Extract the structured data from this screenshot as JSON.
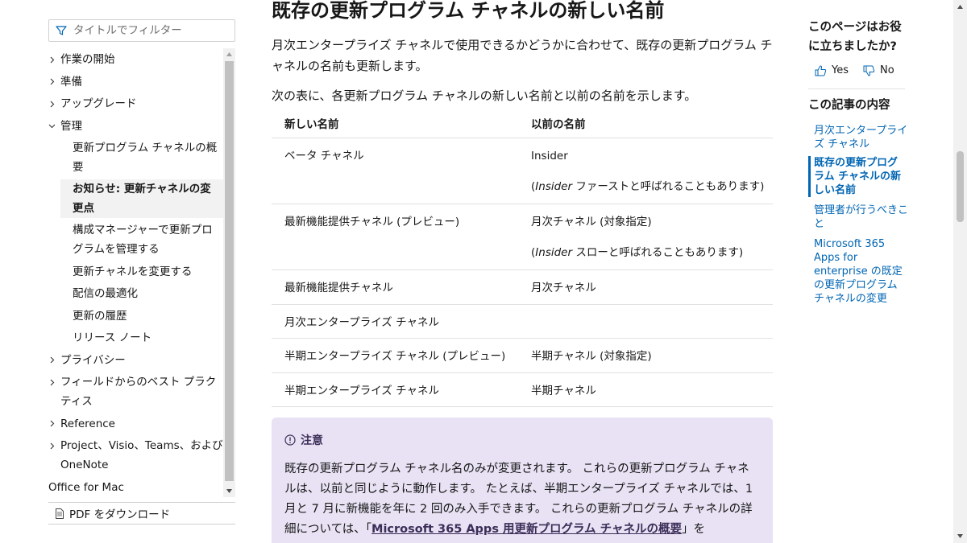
{
  "filter": {
    "placeholder": "タイトルでフィルター"
  },
  "toc": {
    "items": [
      {
        "label": "作業の開始",
        "expandable": true
      },
      {
        "label": "準備",
        "expandable": true
      },
      {
        "label": "アップグレード",
        "expandable": true
      },
      {
        "label": "管理",
        "expandable": true,
        "expanded": true
      }
    ],
    "children": [
      "更新プログラム チャネルの概要",
      "お知らせ: 更新チャネルの変更点",
      "構成マネージャーで更新プログラムを管理する",
      "更新チャネルを変更する",
      "配信の最適化",
      "更新の履歴",
      "リリース ノート"
    ],
    "after": [
      {
        "label": "プライバシー",
        "expandable": true
      },
      {
        "label": "フィールドからのベスト プラクティス",
        "expandable": true
      },
      {
        "label": "Reference",
        "expandable": true
      },
      {
        "label": "Project、Visio、Teams、および OneNote",
        "expandable": true
      },
      {
        "label": "Office for Mac",
        "expandable": false
      }
    ]
  },
  "pdf": {
    "label": "PDF をダウンロード"
  },
  "article": {
    "heading": "既存の更新プログラム チャネルの新しい名前",
    "para1": "月次エンタープライズ チャネルで使用できるかどうかに合わせて、既存の更新プログラム チャネルの名前も更新します。",
    "para2": "次の表に、各更新プログラム チャネルの新しい名前と以前の名前を示します。",
    "table": {
      "headers": [
        "新しい名前",
        "以前の名前"
      ],
      "rows": [
        {
          "new": "ベータ チャネル",
          "old": "Insider",
          "note_it": "Insider",
          "note": " ファーストと呼ばれることもあります)"
        },
        {
          "new": "最新機能提供チャネル (プレビュー)",
          "old": "月次チャネル (対象指定)",
          "note_it": "Insider",
          "note": " スローと呼ばれることもあります)"
        },
        {
          "new": "最新機能提供チャネル",
          "old": "月次チャネル"
        },
        {
          "new": "月次エンタープライズ チャネル",
          "old": ""
        },
        {
          "new": "半期エンタープライズ チャネル (プレビュー)",
          "old": "半期チャネル (対象指定)"
        },
        {
          "new": "半期エンタープライズ チャネル",
          "old": "半期チャネル"
        }
      ]
    },
    "note": {
      "title": "注意",
      "text1": "既存の更新プログラム チャネル名のみが変更されます。 これらの更新プログラム チャネルは、以前と同じように動作します。 たとえば、半期エンタープライズ チャネルでは、1 月と 7 月に新機能を年に 2 回のみ入手できます。 これらの更新プログラム チャネルの詳細については、「",
      "link": "Microsoft 365 Apps 用更新プログラム チャネルの概要",
      "text2": "」を"
    }
  },
  "right": {
    "helpful": "このページはお役に立ちましたか?",
    "yes": "Yes",
    "no": "No",
    "in_article": "この記事の内容",
    "links": [
      "月次エンタープライズ チャネル",
      "既存の更新プログラム チャネルの新しい名前",
      "管理者が行うべきこと",
      "Microsoft 365 Apps for enterprise の既定の更新プログラム チャネルの変更"
    ]
  },
  "colors": {
    "link": "#0065b3",
    "note_bg": "#e8e2f4",
    "note_title": "#3b2e58"
  }
}
